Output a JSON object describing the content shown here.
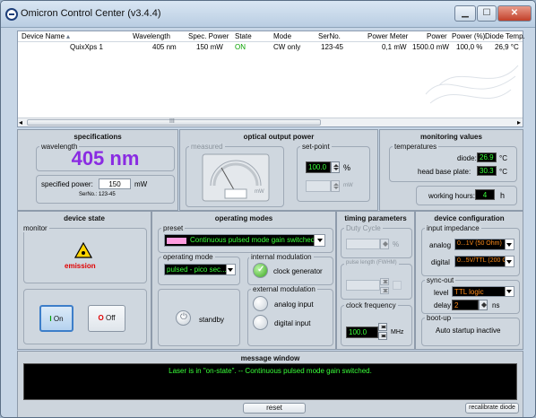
{
  "window": {
    "title": "Omicron Control Center (v3.4.4)",
    "min": "▁",
    "max": "☐",
    "close": "✕"
  },
  "list": {
    "headers": [
      "Device Name",
      "Wavelength",
      "Spec. Power",
      "State",
      "Mode",
      "SerNo.",
      "Power Meter",
      "Power",
      "Power (%)",
      "Diode Temp."
    ],
    "row": [
      "QuixXps 1",
      "405 nm",
      "150 mW",
      "ON",
      "CW only",
      "123-45",
      "0,1 mW",
      "1500.0 mW",
      "100,0 %",
      "26,9 °C"
    ],
    "scroll_left": "◂",
    "scroll_right": "▸",
    "thumb": "III"
  },
  "specifications": {
    "title": "specifications",
    "wavelength_label": "wavelength",
    "wavelength_value": "405 nm",
    "specified_power_label": "specified power:",
    "specified_power_value": "150",
    "specified_power_unit": "mW",
    "serno": "SerNo.: 123-45"
  },
  "optical": {
    "title": "optical output power",
    "measured_label": "measured",
    "meter_unit": "mW",
    "setpoint_label": "set-point",
    "setpoint_value": "100.0",
    "setpoint_unit": "%",
    "mw_unit": "mW"
  },
  "monitoring": {
    "title": "monitoring values",
    "temperatures_label": "temperatures",
    "diode_label": "diode:",
    "diode_value": "26.9",
    "diode_unit": "°C",
    "headbase_label": "head base plate:",
    "headbase_value": "30.3",
    "headbase_unit": "°C",
    "hours_label": "working hours:",
    "hours_value": "4",
    "hours_unit": "h"
  },
  "device_state": {
    "title": "device state",
    "monitor_label": "monitor",
    "emission_label": "emission",
    "on_label": "On",
    "off_label": "Off"
  },
  "operating_modes": {
    "title": "operating modes",
    "preset_label": "preset",
    "preset_value": "Continuous pulsed mode gain switched",
    "operating_mode_label": "operating mode",
    "operating_mode_value": "pulsed - pico sec...",
    "internal_mod_label": "internal modulation",
    "clock_generator": "clock generator",
    "external_mod_label": "external modulation",
    "analog_input": "analog input",
    "digital_input": "digital input",
    "standby": "standby"
  },
  "timing": {
    "title": "timing parameters",
    "duty_cycle_label": "Duty Cycle",
    "duty_unit": "%",
    "pulse_length_label": "pulse length (FWHM)",
    "clock_freq_label": "clock frequency",
    "clock_freq_value": "100.0",
    "clock_freq_unit": "MHz"
  },
  "device_config": {
    "title": "device configuration",
    "input_impedance_label": "input impedance",
    "analog_label": "analog",
    "analog_value": "0...1V (50 Ohm)",
    "digital_label": "digital",
    "digital_value": "0...5V/TTL (200 O",
    "sync_out_label": "sync-out",
    "level_label": "level",
    "level_value": "TTL logic",
    "delay_label": "delay",
    "delay_value": "2",
    "delay_unit": "ns",
    "bootup_label": "boot-up",
    "bootup_value": "Auto startup inactive"
  },
  "message": {
    "title": "message window",
    "text": "Laser is in \"on-state\". -- Continuous pulsed mode gain switched."
  },
  "footer": {
    "reset": "reset",
    "recalibrate": "recalibrate diode"
  },
  "colors": {
    "wavelength": "#8a2be2",
    "lcd_text": "#39ff39",
    "emission": "#e00000"
  }
}
